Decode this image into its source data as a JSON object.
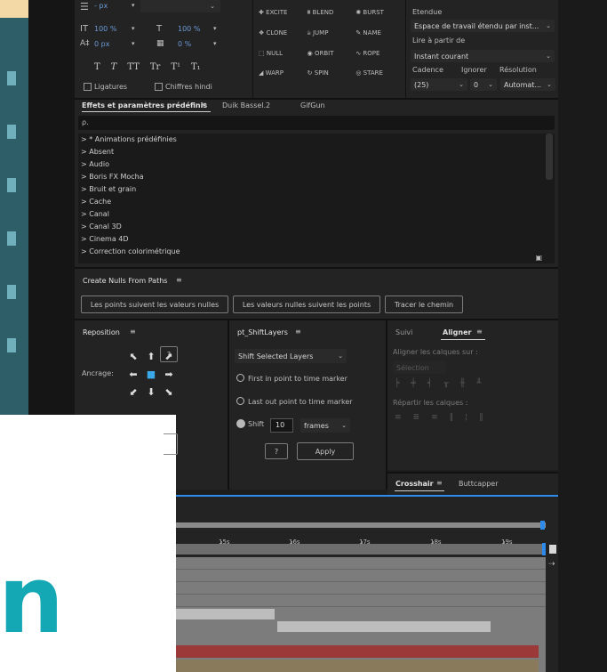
{
  "character": {
    "leading": "- px",
    "scale_h": "100 %",
    "scale_v": "100 %",
    "baseline": "0 px",
    "tsume": "0 %",
    "style_buttons": [
      "T",
      "T",
      "TT",
      "Tr",
      "T¹",
      "T₁"
    ],
    "ligatures_label": "Ligatures",
    "hindi_digits_label": "Chiffres hindi"
  },
  "duik": {
    "buttons": [
      [
        "EXCITE",
        "BLEND",
        "BURST"
      ],
      [
        "CLONE",
        "JUMP",
        "NAME"
      ],
      [
        "NULL",
        "ORBIT",
        "ROPE"
      ],
      [
        "WARP",
        "SPIN",
        "STARE"
      ]
    ]
  },
  "preview": {
    "range_label": "Etendue",
    "range_value": "Espace de travail étendu par inst...",
    "play_from_label": "Lire à partir de",
    "play_from_value": "Instant courant",
    "framerate_label": "Cadence",
    "skip_label": "Ignorer",
    "resolution_label": "Résolution",
    "framerate_value": "(25)",
    "skip_value": "0",
    "resolution_value": "Automat..."
  },
  "effects_panel": {
    "tabs": [
      "Effets et paramètres prédéfinis",
      "Duik Bassel.2",
      "GifGun"
    ],
    "search_placeholder": "ρ.",
    "items": [
      "> * Animations prédéfinies",
      "> Absent",
      "> Audio",
      "> Boris FX Mocha",
      "> Bruit et grain",
      "> Cache",
      "> Canal",
      "> Canal 3D",
      "> Cinema 4D",
      "> Correction colorimétrique"
    ]
  },
  "nulls_panel": {
    "title": "Create Nulls From Paths",
    "buttons": [
      "Les points suivent les valeurs nulles",
      "Les valeurs nulles suivent les points",
      "Tracer le chemin"
    ]
  },
  "reposition": {
    "title": "Reposition",
    "help": "?",
    "anchor_label": "Ancrage:"
  },
  "shiftlayers": {
    "title": "pt_ShiftLayers",
    "mode": "Shift Selected Layers",
    "option1": "First in point to time marker",
    "option2": "Last out point to time marker",
    "shift_label": "Shift",
    "shift_value": "10",
    "unit": "frames",
    "help": "?",
    "apply": "Apply"
  },
  "align": {
    "tabs": [
      "Suivi",
      "Aligner"
    ],
    "align_to_label": "Aligner les calques sur :",
    "align_to_value": "Sélection",
    "distribute_label": "Répartir les calques :"
  },
  "crosshair": {
    "tabs": [
      "Crosshair",
      "Buttcapper"
    ]
  },
  "timeline": {
    "ticks": [
      "15s",
      "16s",
      "17s",
      "18s",
      "19s"
    ]
  },
  "overlay": {
    "letter": "n",
    "colors": {
      "teal": "#14a8b5"
    }
  }
}
